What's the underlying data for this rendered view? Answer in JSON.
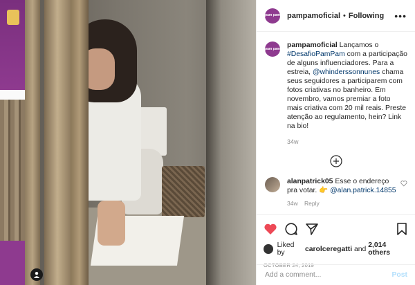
{
  "colors": {
    "brand": "#8e3a8f",
    "like_red": "#ed4956",
    "link": "#00376b",
    "post_disabled": "#b2dffc"
  },
  "header": {
    "avatar_text": "pam pam",
    "username": "pampamoficial",
    "dot": "•",
    "follow_label": "Following",
    "more_icon": "more-horizontal-icon"
  },
  "caption": {
    "username": "pampamoficial",
    "text_1": "Lançamos o",
    "hashtag": "#DesafioPamPam",
    "text_2": "com a participação de alguns influenciadores. Para a estreia,",
    "mention": "@whinderssonnunes",
    "text_3": "chama seus seguidores a participarem com fotos criativas no banheiro. Em novembro, vamos premiar a foto mais criativa com 20 mil reais. Preste atenção ao regulamento, hein? Link na bio!",
    "time": "34w"
  },
  "load_more_icon": "plus-circle-icon",
  "comments": [
    {
      "username": "alanpatrick05",
      "text": "Esse o endereço pra votar.",
      "emoji": "👉",
      "mention": "@alan.patrick.14855",
      "time": "34w",
      "reply_label": "Reply"
    }
  ],
  "actions": {
    "like_icon": "heart-filled-icon",
    "comment_icon": "comment-icon",
    "share_icon": "share-icon",
    "save_icon": "bookmark-icon"
  },
  "likes": {
    "prefix": "Liked by",
    "user": "carolceregatti",
    "and": "and",
    "others": "2,014 others"
  },
  "date": "OCTOBER 24, 2019",
  "add_comment": {
    "placeholder": "Add a comment...",
    "post_label": "Post"
  }
}
